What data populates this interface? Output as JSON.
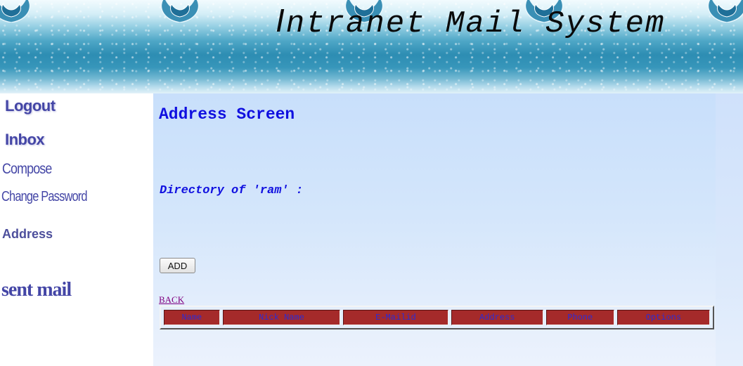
{
  "banner": {
    "title_initial": "I",
    "title_rest": "ntranet Mail System",
    "ornament_icon": "floral-ornament-icon"
  },
  "sidebar": {
    "items": [
      {
        "id": "logout",
        "label": "Logout"
      },
      {
        "id": "inbox",
        "label": "Inbox"
      },
      {
        "id": "compose",
        "label": "Compose"
      },
      {
        "id": "change-password",
        "label": "Change Password"
      },
      {
        "id": "address",
        "label": "Address"
      },
      {
        "id": "sent-mail",
        "label": "sent mail"
      }
    ]
  },
  "main": {
    "title": "Address Screen",
    "directory_label": "Directory of 'ram' :",
    "add_button": "ADD",
    "back_link": "BACK",
    "table": {
      "columns": [
        "Name",
        "Nick Name",
        "E-Mailid",
        "Address",
        "Phone",
        "Options"
      ]
    }
  },
  "colors": {
    "heading_blue": "#1010e0",
    "sidebar_link": "#4446a6",
    "table_header_bg": "#a52a2a",
    "table_header_text": "#2b2bd6",
    "visited_link": "#800080"
  }
}
